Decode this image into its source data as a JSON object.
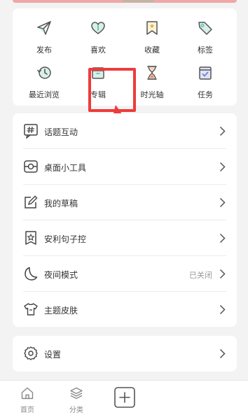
{
  "colors": {
    "accent_teal": "#6cc4b0",
    "accent_red": "#ee3b3b",
    "icon_gray": "#555555",
    "text_gray": "#999999"
  },
  "grid": {
    "items": [
      {
        "label": "发布",
        "icon": "send-icon"
      },
      {
        "label": "喜欢",
        "icon": "heart-icon"
      },
      {
        "label": "收藏",
        "icon": "bookmark-icon"
      },
      {
        "label": "标签",
        "icon": "tag-icon"
      },
      {
        "label": "最近浏览",
        "icon": "history-icon"
      },
      {
        "label": "专辑",
        "icon": "album-icon"
      },
      {
        "label": "时光轴",
        "icon": "hourglass-icon"
      },
      {
        "label": "任务",
        "icon": "task-icon"
      }
    ]
  },
  "menu": {
    "items": [
      {
        "label": "话题互动",
        "icon": "hashtag-icon",
        "value": ""
      },
      {
        "label": "桌面小工具",
        "icon": "widget-icon",
        "value": ""
      },
      {
        "label": "我的草稿",
        "icon": "draft-icon",
        "value": ""
      },
      {
        "label": "安利句子控",
        "icon": "star-card-icon",
        "value": ""
      },
      {
        "label": "夜间模式",
        "icon": "moon-icon",
        "value": "已关闭"
      },
      {
        "label": "主题皮肤",
        "icon": "shirt-icon",
        "value": ""
      }
    ]
  },
  "settings": {
    "label": "设置",
    "icon": "gear-icon"
  },
  "bottom_nav": {
    "items": [
      {
        "label": "首页",
        "icon": "home-icon"
      },
      {
        "label": "分类",
        "icon": "layers-icon"
      }
    ],
    "add_icon": "plus-icon"
  }
}
